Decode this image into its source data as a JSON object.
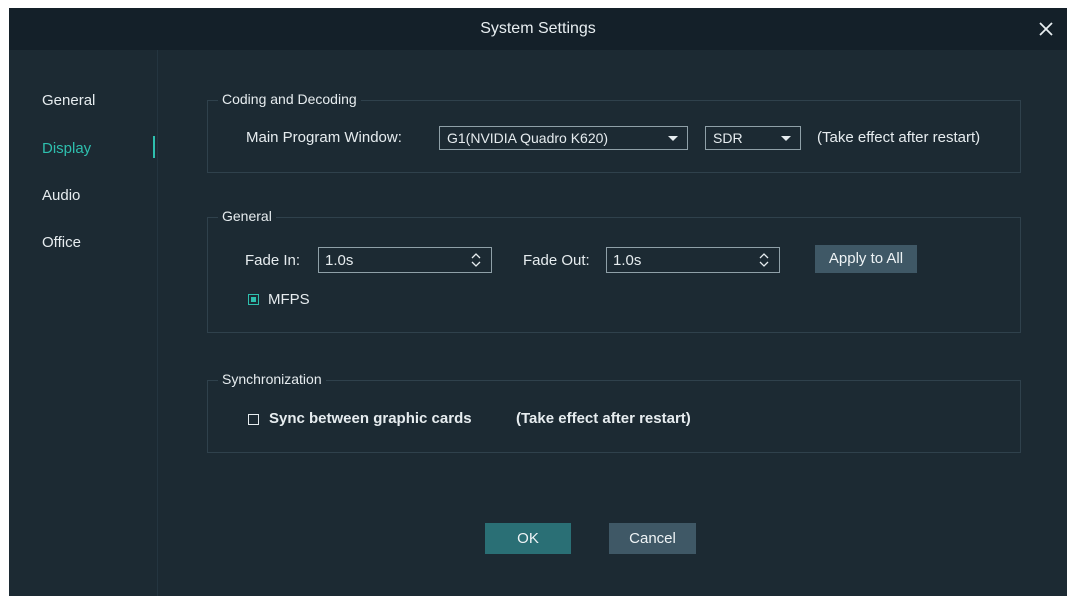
{
  "window": {
    "title": "System Settings"
  },
  "sidebar": {
    "items": [
      {
        "label": "General",
        "active": false
      },
      {
        "label": "Display",
        "active": true
      },
      {
        "label": "Audio",
        "active": false
      },
      {
        "label": "Office",
        "active": false
      }
    ]
  },
  "coding": {
    "legend": "Coding and Decoding",
    "main_window_label": "Main Program Window:",
    "gpu_select": "G1(NVIDIA Quadro K620)",
    "range_select": "SDR",
    "note": "(Take effect after restart)"
  },
  "general": {
    "legend": "General",
    "fade_in_label": "Fade In:",
    "fade_in_value": "1.0s",
    "fade_out_label": "Fade Out:",
    "fade_out_value": "1.0s",
    "apply_label": "Apply to All",
    "mfps_label": "MFPS",
    "mfps_checked": true
  },
  "sync": {
    "legend": "Synchronization",
    "sync_label": "Sync between graphic cards",
    "note": "(Take effect after restart)",
    "sync_checked": false
  },
  "footer": {
    "ok_label": "OK",
    "cancel_label": "Cancel"
  },
  "colors": {
    "background": "#1c2a33",
    "titlebar": "#142029",
    "accent": "#2ebfae",
    "primary_button": "#2a6f75",
    "secondary_button": "#3f5866"
  }
}
